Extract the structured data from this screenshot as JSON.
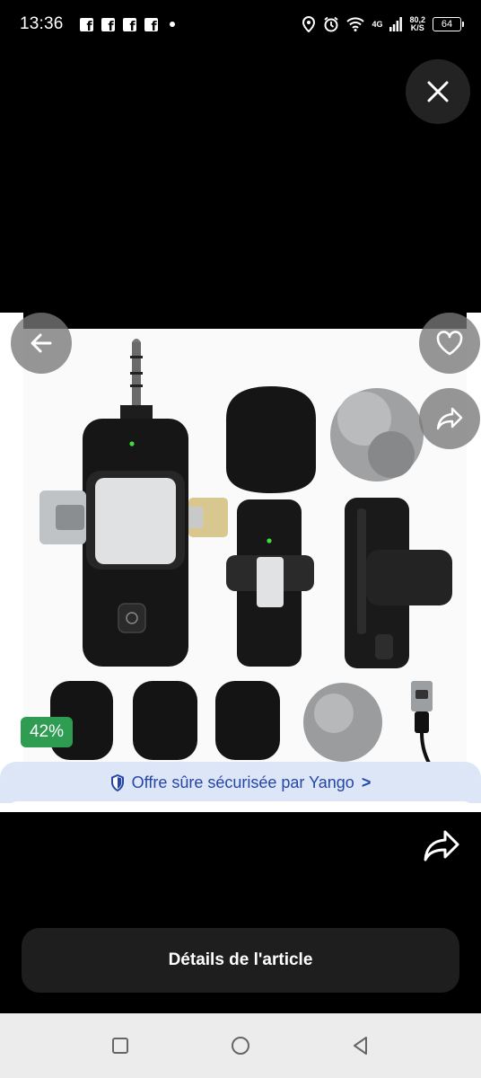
{
  "status_bar": {
    "time": "13:36",
    "network": "4G",
    "speed_value": "80,2",
    "speed_unit": "K/S",
    "battery": "64"
  },
  "product": {
    "discount": "42%"
  },
  "secure_banner": {
    "text": "Offre sûre sécurisée par Yango",
    "chevron": ">"
  },
  "actions": {
    "details_label": "Détails de l'article"
  },
  "colors": {
    "accent_blue": "#2546a6",
    "badge_green": "#2e9d52",
    "banner_bg": "#dde6f7"
  }
}
